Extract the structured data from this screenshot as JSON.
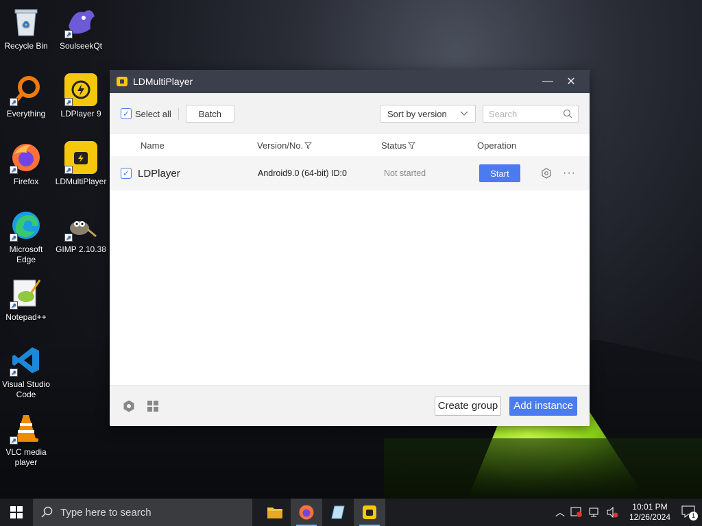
{
  "desktop": {
    "icons": [
      {
        "label": "Recycle Bin",
        "icon": "recycle-bin-icon"
      },
      {
        "label": "SoulseekQt",
        "icon": "soulseek-icon"
      },
      {
        "label": "Everything",
        "icon": "everything-icon"
      },
      {
        "label": "LDPlayer 9",
        "icon": "ldplayer-icon"
      },
      {
        "label": "Firefox",
        "icon": "firefox-icon"
      },
      {
        "label": "LDMultiPlayer",
        "icon": "ldmultiplayer-icon"
      },
      {
        "label": "Microsoft Edge",
        "icon": "edge-icon"
      },
      {
        "label": "GIMP 2.10.38",
        "icon": "gimp-icon"
      },
      {
        "label": "Notepad++",
        "icon": "notepadpp-icon"
      },
      {
        "label": "Visual Studio Code",
        "icon": "vscode-icon"
      },
      {
        "label": "VLC media player",
        "icon": "vlc-icon"
      }
    ]
  },
  "window": {
    "title": "LDMultiPlayer",
    "minimize": "—",
    "close": "✕"
  },
  "toolbar": {
    "select_all": "Select all",
    "batch": "Batch",
    "sort": "Sort by version",
    "search_placeholder": "Search"
  },
  "columns": {
    "name": "Name",
    "version": "Version/No.",
    "status": "Status",
    "operation": "Operation"
  },
  "instances": [
    {
      "name": "LDPlayer",
      "version": "Android9.0 (64-bit) ID:0",
      "status": "Not started",
      "action": "Start"
    }
  ],
  "footer": {
    "create_group": "Create group",
    "add_instance": "Add instance"
  },
  "taskbar": {
    "search_placeholder": "Type here to search",
    "time": "10:01 PM",
    "date": "12/26/2024",
    "notification_count": "1"
  },
  "colors": {
    "accent": "#4a7bef",
    "titlebar": "#3b3f4b",
    "ld_yellow": "#f6c80d"
  }
}
